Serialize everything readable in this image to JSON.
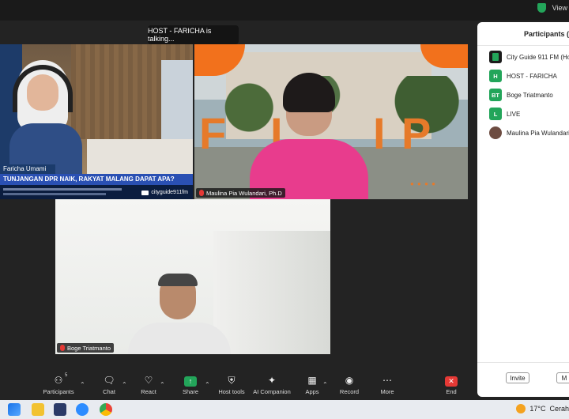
{
  "top_bar": {
    "view_label": "View"
  },
  "talking_banner": "HOST - FARICHA is talking...",
  "tile1": {
    "name_tag": "Faricha Umami",
    "headline": "TUNJANGAN DPR NAIK, RAKYAT MALANG DAPAT APA?",
    "handle": "cityguide911fm"
  },
  "tile2": {
    "name_tag": "Maulina Pia Wulandari, Ph.D",
    "letters": [
      "F",
      "I",
      "I",
      "P"
    ]
  },
  "tile3": {
    "name_tag": "Boge Triatmanto"
  },
  "participants": {
    "title": "Participants (",
    "items": [
      {
        "initials": "",
        "name": "City Guide 911 FM (Host)",
        "color": "#1b1b1b"
      },
      {
        "initials": "H",
        "name": "HOST - FARICHA",
        "color": "#23a55a"
      },
      {
        "initials": "BT",
        "name": "Boge Triatmanto",
        "color": "#23a55a"
      },
      {
        "initials": "L",
        "name": "LIVE",
        "color": "#23a55a"
      },
      {
        "initials": "",
        "name": "Maulina Pia Wulandari, Ph.D",
        "color": "#6d4c41"
      }
    ],
    "invite_label": "Invite",
    "more_label": "M"
  },
  "toolbar": {
    "participants_label": "Participants",
    "participants_count": "5",
    "chat_label": "Chat",
    "react_label": "React",
    "share_label": "Share",
    "host_tools_label": "Host tools",
    "ai_label": "AI Companion",
    "apps_label": "Apps",
    "record_label": "Record",
    "more_label": "More",
    "end_label": "End"
  },
  "taskbar": {
    "temperature": "17°C",
    "weather_text": "Cerah"
  }
}
